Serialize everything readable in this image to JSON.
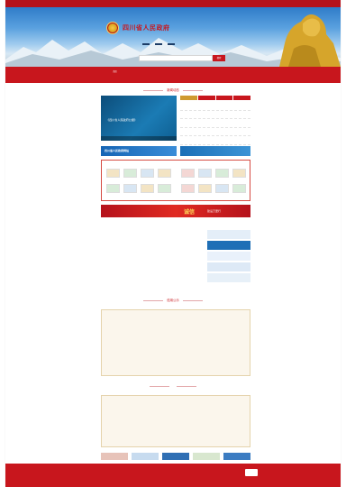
{
  "topbar": {
    "date": "",
    "links": [
      "",
      "",
      "",
      ""
    ]
  },
  "header": {
    "site_title": "四川省人民政府",
    "hero_links": [
      "",
      "",
      ""
    ],
    "search_placeholder": "",
    "search_button": "搜索"
  },
  "nav": {
    "items": [
      "首页",
      "",
      "",
      "",
      "",
      "",
      "",
      "",
      "",
      "",
      "",
      "",
      "",
      ""
    ]
  },
  "news": {
    "section_title": "新闻动态",
    "main_caption": "《四川省人民政府公报》",
    "tabs": [
      "",
      "",
      "",
      ""
    ],
    "items": [
      {
        "title": "",
        "date": ""
      },
      {
        "title": "",
        "date": ""
      },
      {
        "title": "",
        "date": ""
      },
      {
        "title": "",
        "date": ""
      },
      {
        "title": "",
        "date": ""
      }
    ]
  },
  "banners": {
    "left": "四川省人民政府网站",
    "right": ""
  },
  "feature": {
    "label_left": "",
    "label_right": ""
  },
  "red_banner": {
    "big": "诚信",
    "small": "建设万里行"
  },
  "notice": {
    "title_left": "",
    "title_right": "",
    "lines": [
      "",
      "",
      "",
      "",
      "",
      "",
      ""
    ]
  },
  "side_boxes": [
    "",
    "",
    "",
    "",
    ""
  ],
  "publicity": {
    "section_title": "信用公示",
    "left_head": "",
    "right_head": "",
    "rows_left": [
      {
        "a": "",
        "b": ""
      },
      {
        "a": "",
        "b": ""
      },
      {
        "a": "",
        "b": ""
      },
      {
        "a": "",
        "b": ""
      },
      {
        "a": "",
        "b": ""
      },
      {
        "a": "",
        "b": ""
      },
      {
        "a": "",
        "b": ""
      },
      {
        "a": "",
        "b": ""
      },
      {
        "a": "",
        "b": ""
      }
    ],
    "rows_right": [
      {
        "a": "",
        "b": ""
      },
      {
        "a": "",
        "b": ""
      },
      {
        "a": "",
        "b": ""
      },
      {
        "a": "",
        "b": ""
      },
      {
        "a": "",
        "b": ""
      },
      {
        "a": "",
        "b": ""
      },
      {
        "a": "",
        "b": ""
      },
      {
        "a": "",
        "b": ""
      },
      {
        "a": "",
        "b": ""
      }
    ]
  },
  "projects": {
    "section_title": "",
    "items": [
      "",
      "",
      "",
      "",
      "",
      "",
      "",
      "",
      "",
      "",
      "",
      "",
      "",
      "",
      "",
      "",
      "",
      "",
      "",
      "",
      "",
      "",
      "",
      "",
      "",
      "",
      "",
      "",
      "",
      ""
    ]
  },
  "footer": {
    "lines": [
      "",
      "",
      "",
      "",
      ""
    ],
    "badge": ""
  },
  "colors": {
    "brand_red": "#c8161d",
    "gold": "#cf9a2f",
    "beige": "#fbf6ec"
  }
}
